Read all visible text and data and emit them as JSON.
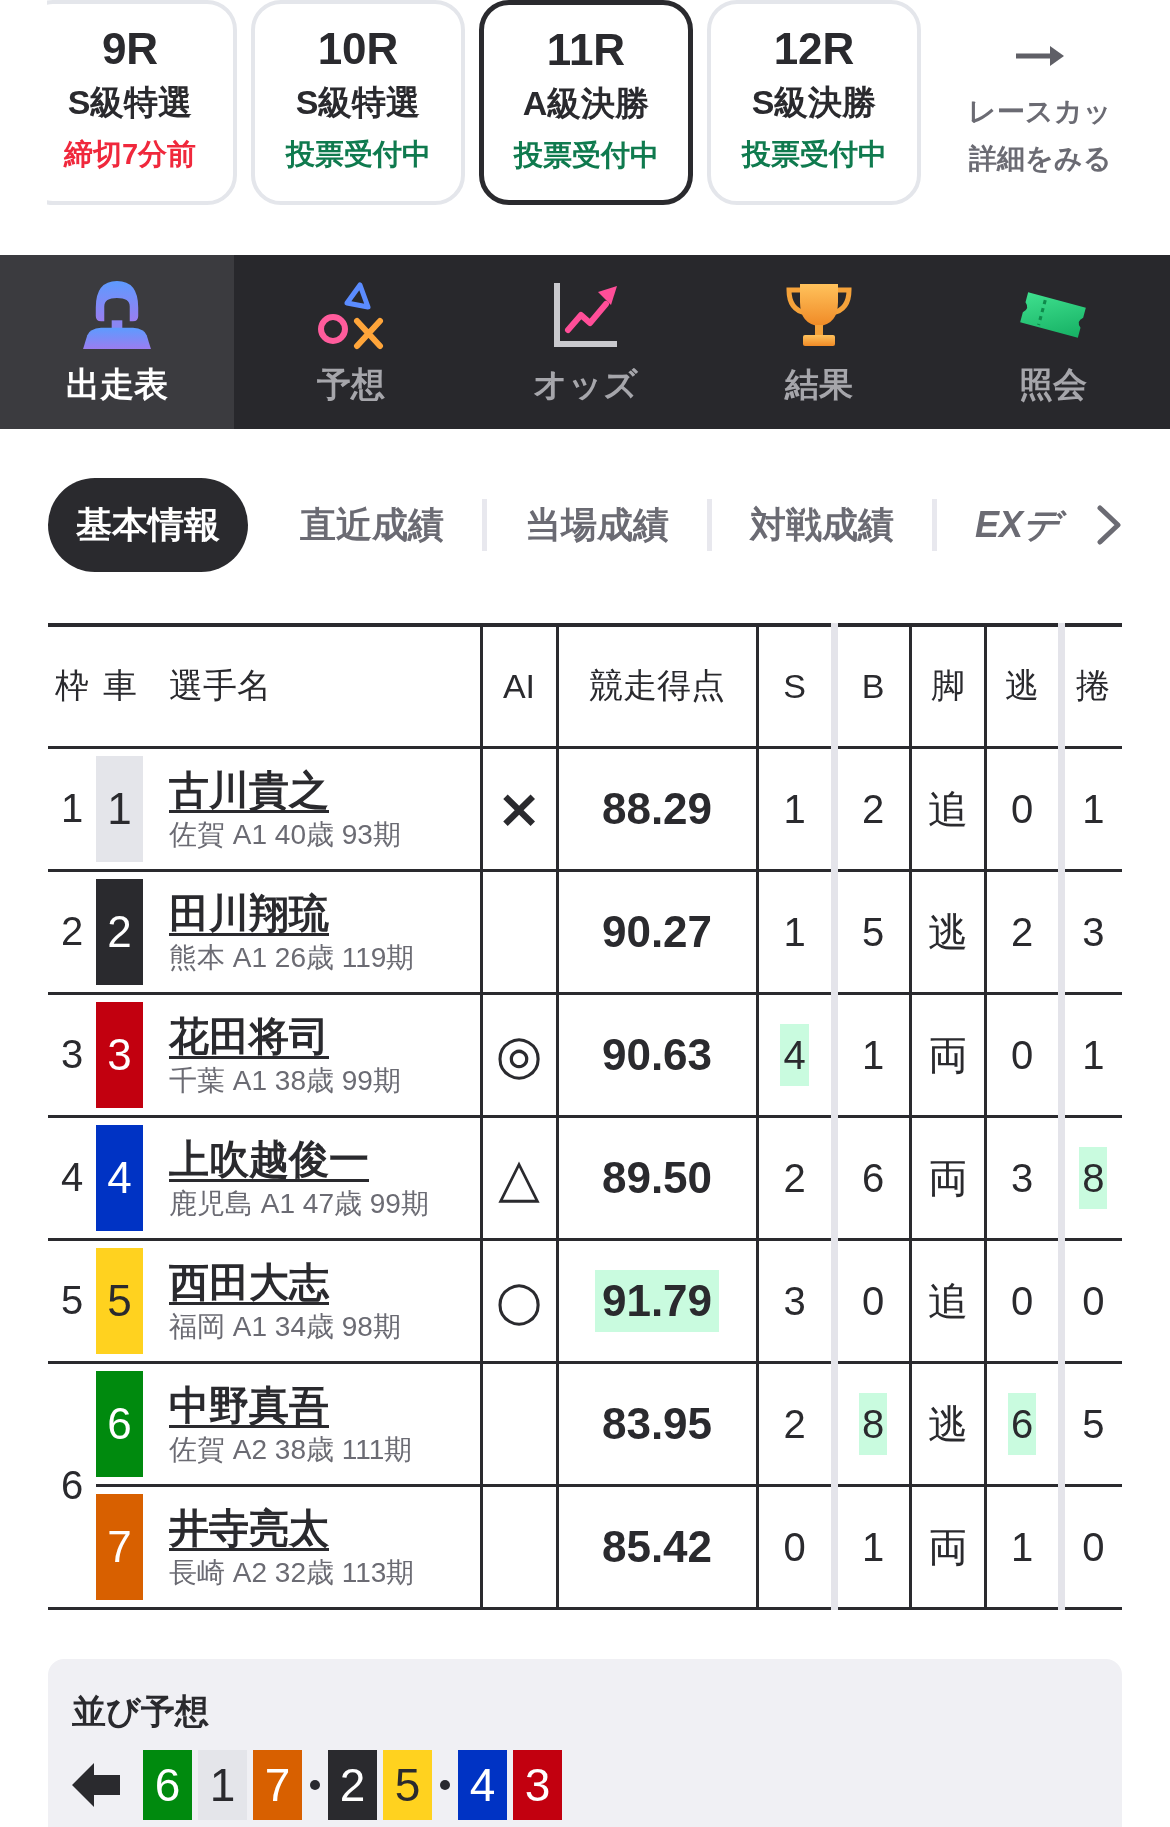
{
  "race_tabs": [
    {
      "race": "9R",
      "grade": "S級特選",
      "status": "締切7分前",
      "kind": "closing",
      "selected": false
    },
    {
      "race": "10R",
      "grade": "S級特選",
      "status": "投票受付中",
      "kind": "open",
      "selected": false
    },
    {
      "race": "11R",
      "grade": "A級決勝",
      "status": "投票受付中",
      "kind": "open",
      "selected": true
    },
    {
      "race": "12R",
      "grade": "S級決勝",
      "status": "投票受付中",
      "kind": "open",
      "selected": false
    }
  ],
  "cup_link": {
    "lines": [
      "レースカッ",
      "詳細をみる"
    ]
  },
  "nav": [
    {
      "label": "出走表",
      "selected": true
    },
    {
      "label": "予想",
      "selected": false
    },
    {
      "label": "オッズ",
      "selected": false
    },
    {
      "label": "結果",
      "selected": false
    },
    {
      "label": "照会",
      "selected": false
    }
  ],
  "info_tabs": [
    {
      "label": "基本情報",
      "kind": "text",
      "selected": true
    },
    {
      "label": "直近成績",
      "kind": "text",
      "selected": false
    },
    {
      "label": "当場成績",
      "kind": "text",
      "selected": false
    },
    {
      "label": "対戦成績",
      "kind": "text",
      "selected": false
    },
    {
      "label": "EXデ",
      "kind": "logo",
      "selected": false
    }
  ],
  "table": {
    "columns": [
      "枠",
      "車",
      "選手名",
      "AI",
      "競走得点",
      "S",
      "B",
      "脚",
      "逃",
      "捲"
    ],
    "frames": [
      {
        "frame": "1",
        "riders": [
          {
            "car": "1",
            "color": "#e4e5ea",
            "name": "古川貴之",
            "profile": "佐賀 A1 40歳 93期",
            "ai": "×",
            "score": {
              "value": "88.29",
              "highlighted": false
            },
            "stats": [
              {
                "value": "1",
                "highlighted": false
              },
              {
                "value": "2",
                "highlighted": false
              },
              {
                "value": "追",
                "highlighted": false
              },
              {
                "value": "0",
                "highlighted": false
              },
              {
                "value": "1",
                "highlighted": false
              }
            ]
          }
        ]
      },
      {
        "frame": "2",
        "riders": [
          {
            "car": "2",
            "color": "#2a2a2e",
            "name": "田川翔琉",
            "profile": "熊本 A1 26歳 119期",
            "score": {
              "value": "90.27",
              "highlighted": false
            },
            "stats": [
              {
                "value": "1",
                "highlighted": false
              },
              {
                "value": "5",
                "highlighted": false
              },
              {
                "value": "逃",
                "highlighted": false
              },
              {
                "value": "2",
                "highlighted": false
              },
              {
                "value": "3",
                "highlighted": false
              }
            ]
          }
        ]
      },
      {
        "frame": "3",
        "riders": [
          {
            "car": "3",
            "color": "#c2000f",
            "name": "花田将司",
            "profile": "千葉 A1 38歳 99期",
            "ai": "◎",
            "score": {
              "value": "90.63",
              "highlighted": false
            },
            "stats": [
              {
                "value": "4",
                "highlighted": true
              },
              {
                "value": "1",
                "highlighted": false
              },
              {
                "value": "両",
                "highlighted": false
              },
              {
                "value": "0",
                "highlighted": false
              },
              {
                "value": "1",
                "highlighted": false
              }
            ]
          }
        ]
      },
      {
        "frame": "4",
        "riders": [
          {
            "car": "4",
            "color": "#0033c4",
            "name": "上吹越俊一",
            "profile": "鹿児島 A1 47歳 99期",
            "ai": "△",
            "score": {
              "value": "89.50",
              "highlighted": false
            },
            "stats": [
              {
                "value": "2",
                "highlighted": false
              },
              {
                "value": "6",
                "highlighted": false
              },
              {
                "value": "両",
                "highlighted": false
              },
              {
                "value": "3",
                "highlighted": false
              },
              {
                "value": "8",
                "highlighted": true
              }
            ]
          }
        ]
      },
      {
        "frame": "5",
        "riders": [
          {
            "car": "5",
            "color": "#ffd21f",
            "name": "西田大志",
            "profile": "福岡 A1 34歳 98期",
            "ai": "○",
            "score": {
              "value": "91.79",
              "highlighted": true
            },
            "stats": [
              {
                "value": "3",
                "highlighted": false
              },
              {
                "value": "0",
                "highlighted": false
              },
              {
                "value": "追",
                "highlighted": false
              },
              {
                "value": "0",
                "highlighted": false
              },
              {
                "value": "0",
                "highlighted": false
              }
            ]
          }
        ]
      },
      {
        "frame": "6",
        "riders": [
          {
            "car": "6",
            "color": "#008a0e",
            "name": "中野真吾",
            "profile": "佐賀 A2 38歳 111期",
            "score": {
              "value": "83.95",
              "highlighted": false
            },
            "stats": [
              {
                "value": "2",
                "highlighted": false
              },
              {
                "value": "8",
                "highlighted": true
              },
              {
                "value": "逃",
                "highlighted": false
              },
              {
                "value": "6",
                "highlighted": true
              },
              {
                "value": "5",
                "highlighted": false
              }
            ]
          },
          {
            "car": "7",
            "color": "#d86000",
            "name": "井寺亮太",
            "profile": "長崎 A2 32歳 113期",
            "score": {
              "value": "85.42",
              "highlighted": false
            },
            "stats": [
              {
                "value": "0",
                "highlighted": false
              },
              {
                "value": "1",
                "highlighted": false
              },
              {
                "value": "両",
                "highlighted": false
              },
              {
                "value": "1",
                "highlighted": false
              },
              {
                "value": "0",
                "highlighted": false
              }
            ]
          }
        ]
      }
    ]
  },
  "line_forecast": {
    "title": "並び予想",
    "groups": [
      {
        "cars": [
          {
            "car": "6",
            "color": "#008a0e"
          },
          {
            "car": "1",
            "color": "#e4e5ea"
          },
          {
            "car": "7",
            "color": "#d86000"
          }
        ]
      },
      {
        "cars": [
          {
            "car": "2",
            "color": "#2a2a2e"
          },
          {
            "car": "5",
            "color": "#ffd21f"
          }
        ]
      },
      {
        "cars": [
          {
            "car": "4",
            "color": "#0033c4"
          },
          {
            "car": "3",
            "color": "#c2000f"
          }
        ]
      }
    ]
  }
}
